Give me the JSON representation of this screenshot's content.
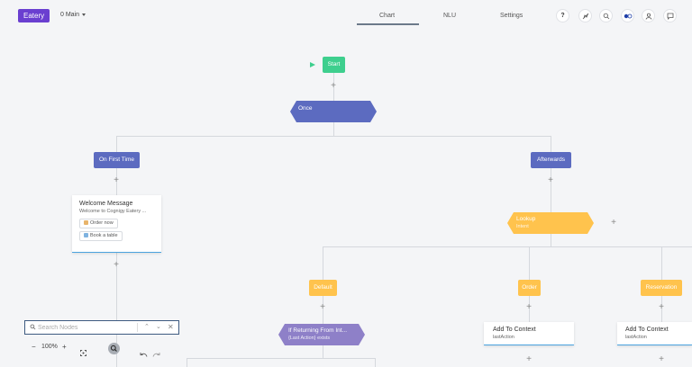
{
  "header": {
    "brand": "Eatery",
    "flow_name": "0 Main",
    "tabs": [
      {
        "label": "Chart",
        "active": true
      },
      {
        "label": "NLU"
      },
      {
        "label": "Settings"
      }
    ],
    "icons": [
      "help-icon",
      "rocket-icon",
      "search-icon",
      "toggle-icon",
      "user-icon",
      "chat-icon"
    ]
  },
  "nodes": {
    "start": "Start",
    "once": "Once",
    "on_first_time": "On First Time",
    "afterwards": "Afterwards",
    "welcome": {
      "title": "Welcome Message",
      "subtitle": "Welcome to Cognigy Eatery ...",
      "chips": [
        "Order now",
        "Book a table"
      ]
    },
    "lookup": {
      "title": "Lookup",
      "subtitle": "Intent"
    },
    "default": "Default",
    "order": "Order",
    "reservation": "Reservation",
    "if_returning": {
      "title": "If Returning From Int...",
      "subtitle": "{Last Action} exists"
    },
    "add_context_1": {
      "title": "Add To Context",
      "subtitle": "lastAction"
    },
    "add_context_2": {
      "title": "Add To Context",
      "subtitle": "lastAction"
    }
  },
  "search": {
    "placeholder": "Search Nodes"
  },
  "zoom": {
    "level": "100%",
    "minus": "−",
    "plus": "+"
  },
  "colors": {
    "brand": "#6a3fd0",
    "start": "#3ecf8e",
    "blue": "#5c6bc0",
    "yellow": "#ffc34d",
    "purple": "#8e80c8"
  }
}
